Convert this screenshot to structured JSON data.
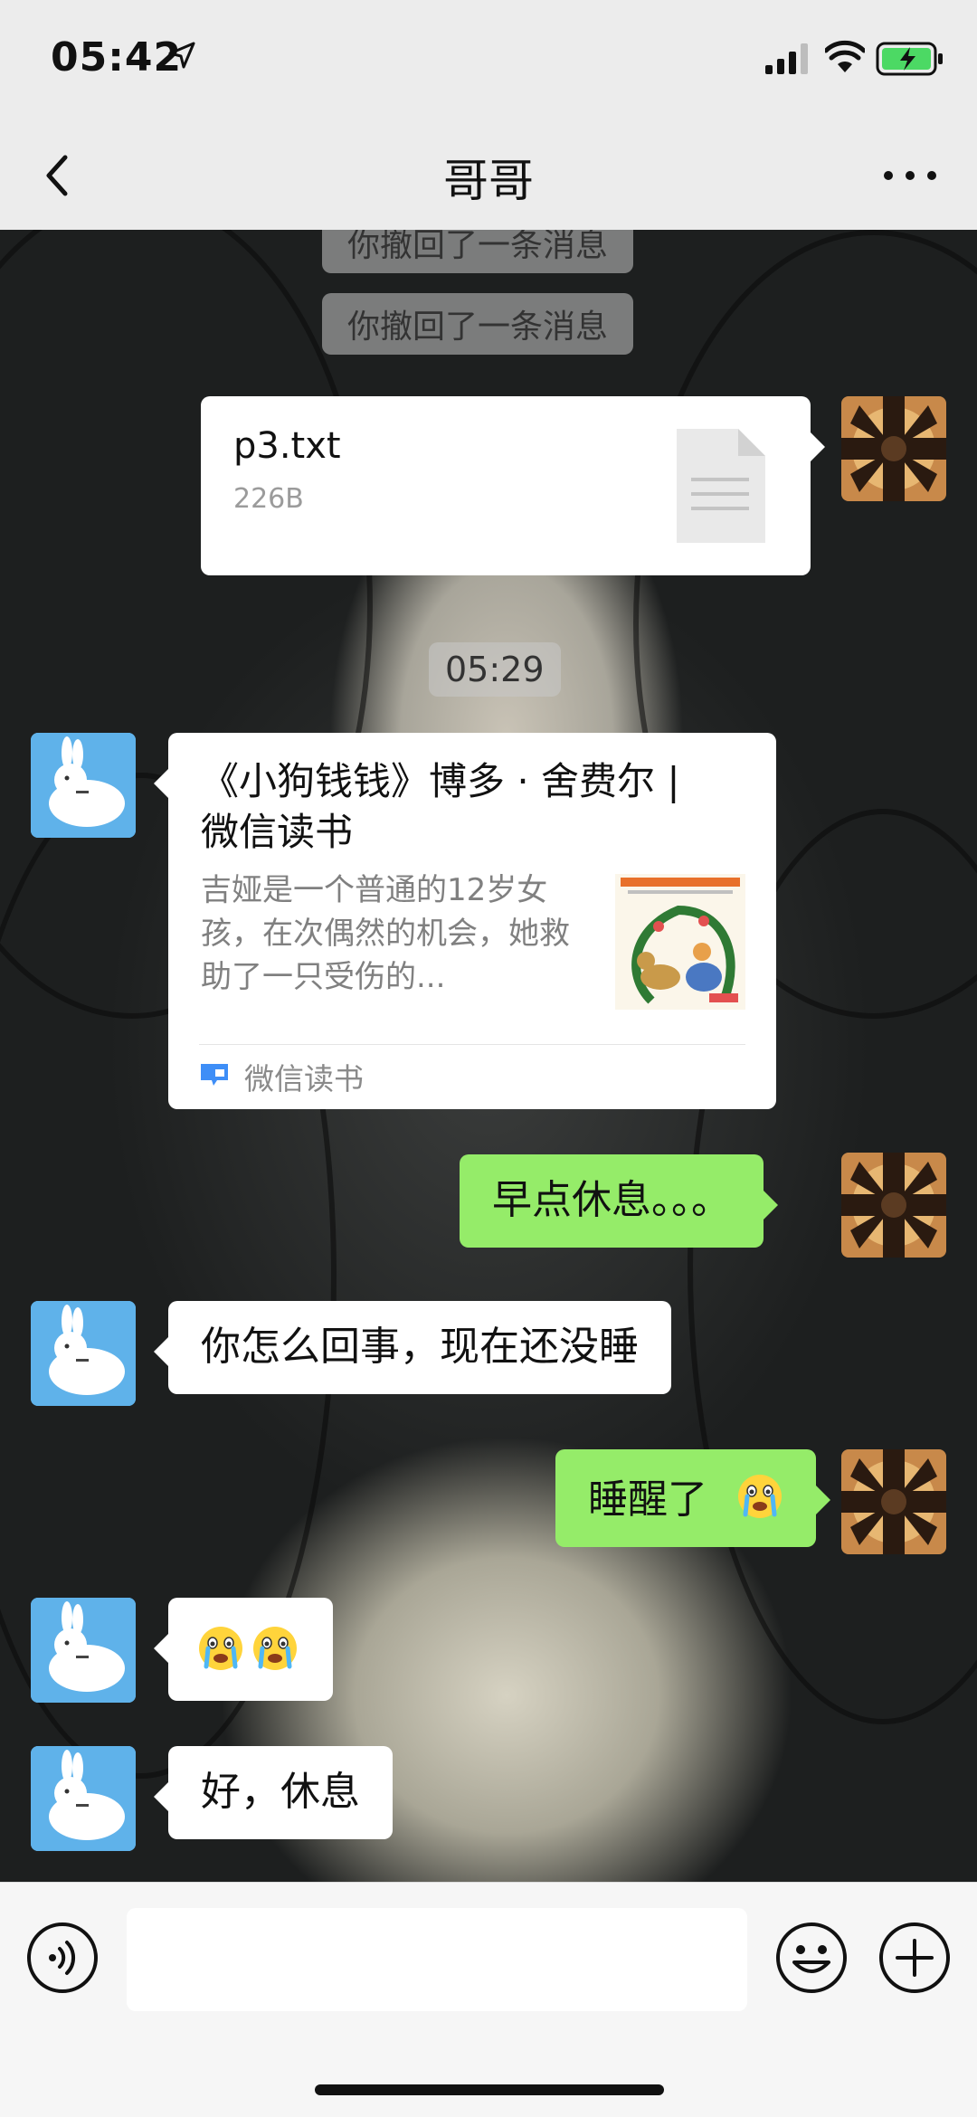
{
  "status_bar": {
    "time": "05:42"
  },
  "nav": {
    "title": "哥哥"
  },
  "chat": {
    "system_notices": [
      {
        "text": "你撤回了一条消息"
      },
      {
        "text": "你撤回了一条消息"
      }
    ],
    "timestamp": "05:29",
    "file_message": {
      "name": "p3.txt",
      "size": "226B"
    },
    "link_card": {
      "title": "《小狗钱钱》博多 · 舍费尔 | 微信读书",
      "description": "吉娅是一个普通的12岁女孩，在次偶然的机会，她救助了一只受伤的...",
      "source": "微信读书"
    },
    "messages": [
      {
        "from": "me",
        "text": "早点休息。。。"
      },
      {
        "from": "brother",
        "text": "你怎么回事，现在还没睡"
      },
      {
        "from": "me",
        "text": "睡醒了",
        "emoji": "crying-emoji"
      },
      {
        "from": "brother",
        "text": "",
        "emoji": "crying-emoji x2"
      },
      {
        "from": "brother",
        "text": "好，休息"
      }
    ]
  },
  "input_bar": {
    "placeholder": ""
  },
  "colors": {
    "bubble_green": "#95ec69",
    "bubble_white": "#ffffff",
    "avatar_bro_bg": "#5fb2ea"
  }
}
